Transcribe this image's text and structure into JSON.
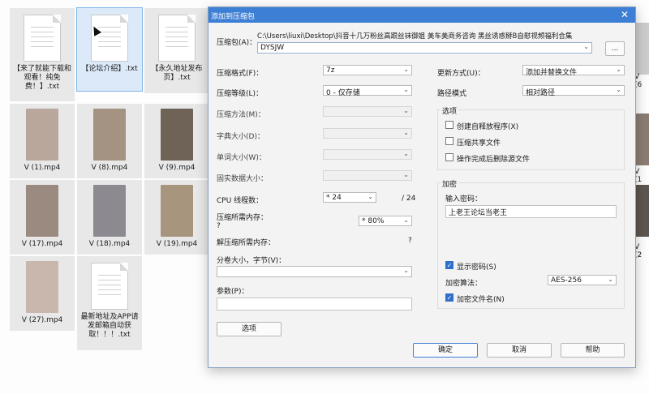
{
  "desktop": {
    "files": [
      {
        "name": "【来了就能下载和观看！纯免费！】.txt",
        "type": "doc"
      },
      {
        "name": "【论坛介绍】.txt",
        "type": "doc",
        "selected": true
      },
      {
        "name": "【永久地址发布页】.txt",
        "type": "doc"
      },
      {
        "name": "V (1).mp4",
        "type": "video",
        "color": "#b8a79a"
      },
      {
        "name": "V (8).mp4",
        "type": "video",
        "color": "#a49282"
      },
      {
        "name": "V (9).mp4",
        "type": "video",
        "color": "#6f6256"
      },
      {
        "name": "V (17).mp4",
        "type": "video",
        "color": "#9a8a80"
      },
      {
        "name": "V (18).mp4",
        "type": "video",
        "color": "#8c8a90"
      },
      {
        "name": "V (19).mp4",
        "type": "video",
        "color": "#a8957e"
      },
      {
        "name": "V (27).mp4",
        "type": "video",
        "color": "#c9b7ae"
      },
      {
        "name": "最新地址及APP请发邮箱自动获取！！！.txt",
        "type": "doc"
      }
    ],
    "right_labels": [
      "V (6",
      "V (1",
      "V (2"
    ]
  },
  "dialog": {
    "title": "添加到压缩包",
    "close_glyph": "✕",
    "archive_label": "压缩包(A)：",
    "archive_path": "C:\\Users\\liuxi\\Desktop\\抖音十几万粉丝高跟丝袜御姐 美车美商务咨询 黑丝诱惑掰B自慰视频福利合集",
    "archive_name": "DYSJW",
    "browse_label": "...",
    "format_label": "压缩格式(F)：",
    "format_value": "7z",
    "level_label": "压缩等级(L)：",
    "level_value": "0 - 仅存储",
    "method_label": "压缩方法(M)：",
    "dict_label": "字典大小(D)：",
    "word_label": "单词大小(W)：",
    "solid_label": "固实数据大小：",
    "cpu_label": "CPU 线程数：",
    "cpu_value": "* 24",
    "cpu_total": "/ 24",
    "mem_comp_label": "压缩所需内存：",
    "mem_comp_q": "?",
    "mem_comp_value": "* 80%",
    "mem_decomp_label": "解压缩所需内存：",
    "mem_decomp_q": "?",
    "split_label": "分卷大小，字节(V)：",
    "params_label": "参数(P)：",
    "options_button": "选项",
    "update_label": "更新方式(U)：",
    "update_value": "添加并替换文件",
    "path_label": "路径模式",
    "path_value": "相对路径",
    "options_group": "选项",
    "opt_sfx": "创建自释放程序(X)",
    "opt_shared": "压缩共享文件",
    "opt_delete": "操作完成后删除源文件",
    "encrypt_group": "加密",
    "pwd_label": "输入密码：",
    "pwd_value": "上老王论坛当老王",
    "show_pwd": "显示密码(S)",
    "enc_method_label": "加密算法：",
    "enc_method_value": "AES-256",
    "enc_names": "加密文件名(N)",
    "ok": "确定",
    "cancel": "取消",
    "help": "帮助",
    "arrow_glyph": "⌄"
  }
}
